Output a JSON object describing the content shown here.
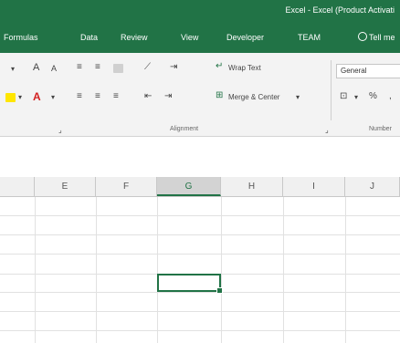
{
  "window": {
    "title": "Excel - Excel (Product Activati"
  },
  "tabs": [
    {
      "label": "Formulas"
    },
    {
      "label": "Data"
    },
    {
      "label": "Review"
    },
    {
      "label": "View"
    },
    {
      "label": "Developer"
    },
    {
      "label": "TEAM"
    }
  ],
  "tell_me": {
    "label": "Tell me"
  },
  "ribbon": {
    "wrap_text": "Wrap Text",
    "merge_center": "Merge & Center",
    "number_format": "General",
    "alignment_group": "Alignment",
    "number_group": "Number"
  },
  "columns": [
    {
      "label": "E"
    },
    {
      "label": "F"
    },
    {
      "label": "G"
    },
    {
      "label": "H"
    },
    {
      "label": "I"
    },
    {
      "label": "J"
    }
  ],
  "colors": {
    "accent": "#217346",
    "font_red": "#d32020",
    "highlight_yellow": "#ffe600"
  }
}
